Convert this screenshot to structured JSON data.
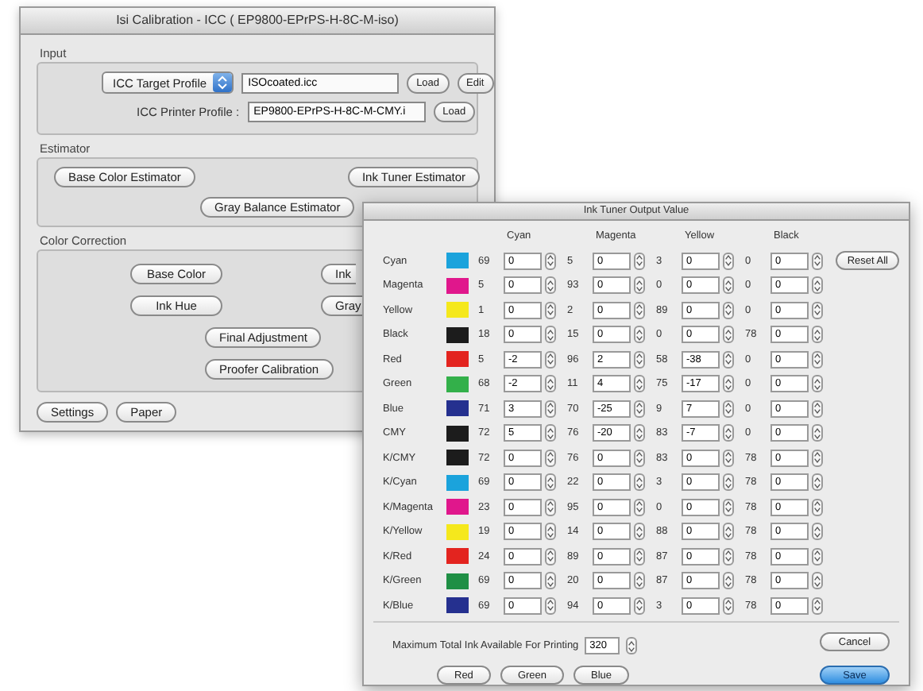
{
  "back_window": {
    "title": "Isi Calibration - ICC ( EP9800-EPrPS-H-8C-M-iso)",
    "input": {
      "label": "Input",
      "target_popup": "ICC Target Profile",
      "target_value": "ISOcoated.icc",
      "target_buttons": [
        "Load",
        "Edit"
      ],
      "printer_label": "ICC Printer Profile :",
      "printer_value": "EP9800-EPrPS-H-8C-M-CMY.i",
      "printer_buttons": [
        "Load"
      ]
    },
    "estimator": {
      "label": "Estimator",
      "buttons": [
        "Base Color Estimator",
        "Ink Tuner Estimator",
        "Gray Balance Estimator"
      ]
    },
    "color_correction": {
      "label": "Color Correction",
      "buttons": [
        "Base Color",
        "Ink",
        "Ink Hue",
        "Gray",
        "Final Adjustment",
        "Proofer Calibration"
      ]
    },
    "bottom_buttons": [
      "Settings",
      "Paper"
    ]
  },
  "front_window": {
    "title": "Ink Tuner Output Value",
    "columns": [
      "Cyan",
      "Magenta",
      "Yellow",
      "Black"
    ],
    "rows": [
      {
        "name": "Cyan",
        "color": "#1ba3dc",
        "values": [
          [
            "69",
            "0"
          ],
          [
            "5",
            "0"
          ],
          [
            "3",
            "0"
          ],
          [
            "0",
            "0"
          ]
        ]
      },
      {
        "name": "Magenta",
        "color": "#e0178c",
        "values": [
          [
            "5",
            "0"
          ],
          [
            "93",
            "0"
          ],
          [
            "0",
            "0"
          ],
          [
            "0",
            "0"
          ]
        ]
      },
      {
        "name": "Yellow",
        "color": "#f5e81c",
        "values": [
          [
            "1",
            "0"
          ],
          [
            "2",
            "0"
          ],
          [
            "89",
            "0"
          ],
          [
            "0",
            "0"
          ]
        ]
      },
      {
        "name": "Black",
        "color": "#1c1c1c",
        "values": [
          [
            "18",
            "0"
          ],
          [
            "15",
            "0"
          ],
          [
            "0",
            "0"
          ],
          [
            "78",
            "0"
          ]
        ]
      },
      {
        "name": "Red",
        "color": "#e3241f",
        "values": [
          [
            "5",
            "-2"
          ],
          [
            "96",
            "2"
          ],
          [
            "58",
            "-38"
          ],
          [
            "0",
            "0"
          ]
        ]
      },
      {
        "name": "Green",
        "color": "#33b04a",
        "values": [
          [
            "68",
            "-2"
          ],
          [
            "11",
            "4"
          ],
          [
            "75",
            "-17"
          ],
          [
            "0",
            "0"
          ]
        ]
      },
      {
        "name": "Blue",
        "color": "#25308f",
        "values": [
          [
            "71",
            "3"
          ],
          [
            "70",
            "-25"
          ],
          [
            "9",
            "7"
          ],
          [
            "0",
            "0"
          ]
        ]
      },
      {
        "name": "CMY",
        "color": "#1c1c1c",
        "values": [
          [
            "72",
            "5"
          ],
          [
            "76",
            "-20"
          ],
          [
            "83",
            "-7"
          ],
          [
            "0",
            "0"
          ]
        ]
      },
      {
        "name": "K/CMY",
        "color": "#1c1c1c",
        "values": [
          [
            "72",
            "0"
          ],
          [
            "76",
            "0"
          ],
          [
            "83",
            "0"
          ],
          [
            "78",
            "0"
          ]
        ]
      },
      {
        "name": "K/Cyan",
        "color": "#1ba3dc",
        "values": [
          [
            "69",
            "0"
          ],
          [
            "22",
            "0"
          ],
          [
            "3",
            "0"
          ],
          [
            "78",
            "0"
          ]
        ]
      },
      {
        "name": "K/Magenta",
        "color": "#e0178c",
        "values": [
          [
            "23",
            "0"
          ],
          [
            "95",
            "0"
          ],
          [
            "0",
            "0"
          ],
          [
            "78",
            "0"
          ]
        ]
      },
      {
        "name": "K/Yellow",
        "color": "#f5e81c",
        "values": [
          [
            "19",
            "0"
          ],
          [
            "14",
            "0"
          ],
          [
            "88",
            "0"
          ],
          [
            "78",
            "0"
          ]
        ]
      },
      {
        "name": "K/Red",
        "color": "#e3241f",
        "values": [
          [
            "24",
            "0"
          ],
          [
            "89",
            "0"
          ],
          [
            "87",
            "0"
          ],
          [
            "78",
            "0"
          ]
        ]
      },
      {
        "name": "K/Green",
        "color": "#1f8f45",
        "values": [
          [
            "69",
            "0"
          ],
          [
            "20",
            "0"
          ],
          [
            "87",
            "0"
          ],
          [
            "78",
            "0"
          ]
        ]
      },
      {
        "name": "K/Blue",
        "color": "#25308f",
        "values": [
          [
            "69",
            "0"
          ],
          [
            "94",
            "0"
          ],
          [
            "3",
            "0"
          ],
          [
            "78",
            "0"
          ]
        ]
      }
    ],
    "reset_button": "Reset All",
    "max_ink_label": "Maximum Total Ink Available For Printing",
    "max_ink_value": "320",
    "color_buttons": [
      "Red",
      "Green",
      "Blue"
    ],
    "action_buttons": [
      {
        "label": "Cancel",
        "default": false
      },
      {
        "label": "Save",
        "default": true
      }
    ]
  }
}
